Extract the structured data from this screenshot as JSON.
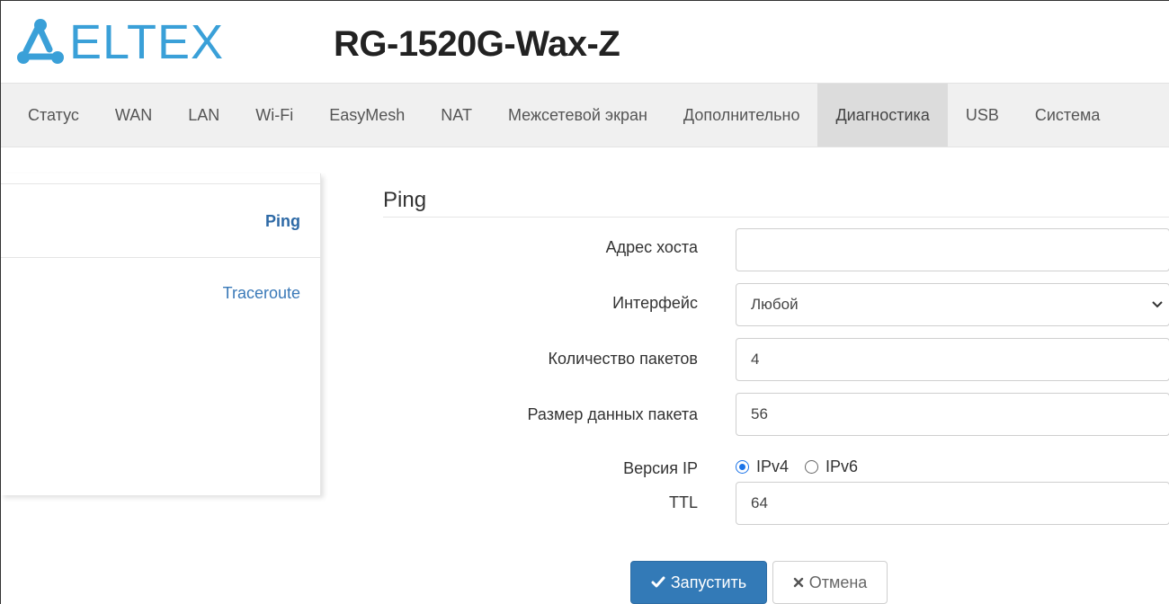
{
  "header": {
    "brand": "ELTEX",
    "model": "RG-1520G-Wax-Z",
    "brand_color": "#3aa0d8"
  },
  "nav": {
    "items": [
      {
        "label": "Статус"
      },
      {
        "label": "WAN"
      },
      {
        "label": "LAN"
      },
      {
        "label": "Wi-Fi"
      },
      {
        "label": "EasyMesh"
      },
      {
        "label": "NAT"
      },
      {
        "label": "Межсетевой экран"
      },
      {
        "label": "Дополнительно"
      },
      {
        "label": "Диагностика",
        "active": true
      },
      {
        "label": "USB"
      },
      {
        "label": "Система"
      }
    ]
  },
  "sidebar": {
    "items": [
      {
        "label": "Ping",
        "active": true
      },
      {
        "label": "Traceroute"
      }
    ]
  },
  "form": {
    "title": "Ping",
    "host": {
      "label": "Адрес хоста",
      "value": ""
    },
    "interface": {
      "label": "Интерфейс",
      "value": "Любой"
    },
    "count": {
      "label": "Количество пакетов",
      "value": "4"
    },
    "size": {
      "label": "Размер данных пакета",
      "value": "56"
    },
    "ip_version": {
      "label": "Версия IP",
      "options": [
        "IPv4",
        "IPv6"
      ],
      "selected": "IPv4"
    },
    "ttl": {
      "label": "TTL",
      "value": "64"
    },
    "buttons": {
      "run": "Запустить",
      "cancel": "Отмена"
    }
  },
  "colors": {
    "primary_button": "#337ab7",
    "link": "#3a79b8",
    "radio_checked": "#1a73e8"
  }
}
